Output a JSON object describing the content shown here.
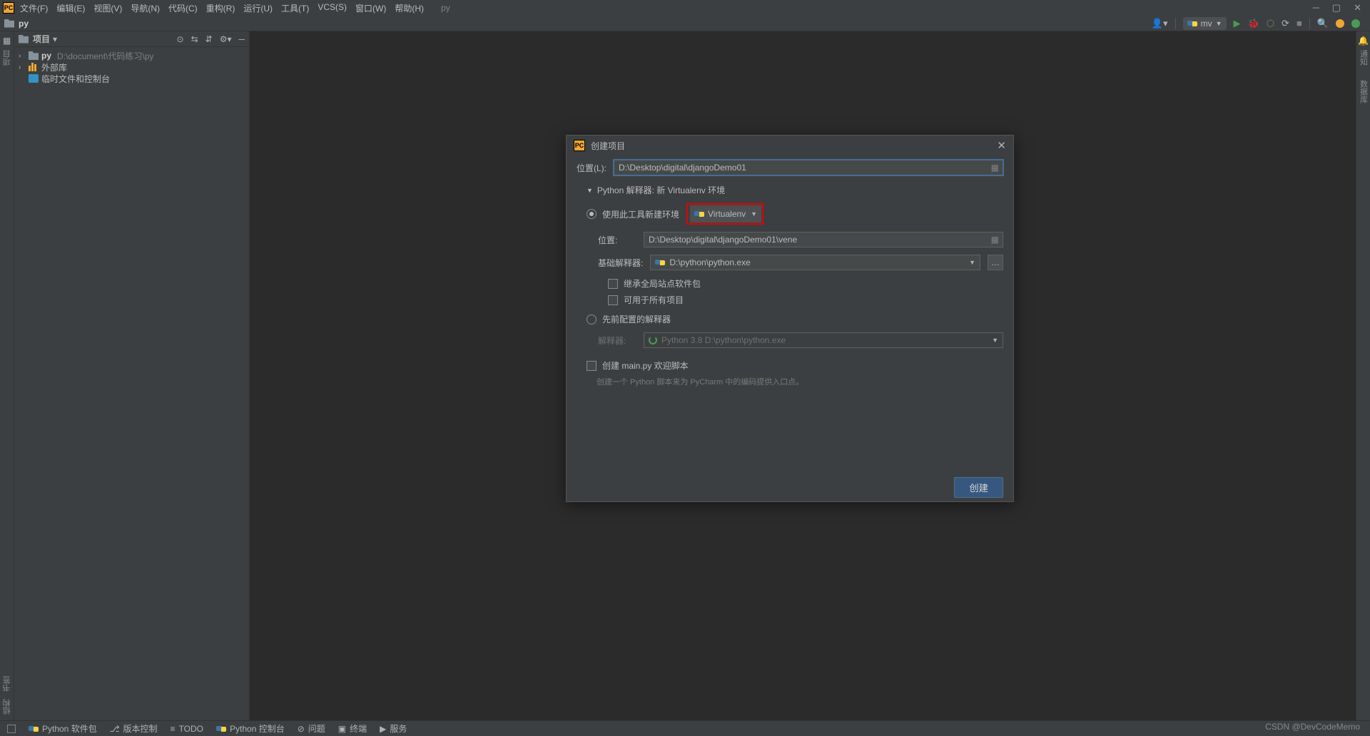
{
  "menu": {
    "file": "文件(F)",
    "edit": "编辑(E)",
    "view": "视图(V)",
    "nav": "导航(N)",
    "code": "代码(C)",
    "refactor": "重构(R)",
    "run": "运行(U)",
    "tools": "工具(T)",
    "vcs": "VCS(S)",
    "window": "窗口(W)",
    "help": "帮助(H)",
    "proj": "py"
  },
  "crumb": {
    "name": "py",
    "config": "mv"
  },
  "sidebar": {
    "title": "项目",
    "root": "py",
    "root_path": "D:\\document\\代码练习\\py",
    "libs": "外部库",
    "scratch": "临时文件和控制台"
  },
  "dialog": {
    "title": "创建项目",
    "loc_label": "位置(L):",
    "loc_value": "D:\\Desktop\\digital\\djangoDemo01",
    "section": "Python 解释器: 新 Virtualenv 环境",
    "radio_new": "使用此工具新建环境",
    "venv_label": "Virtualenv",
    "env_loc_label": "位置:",
    "env_loc_value": "D:\\Desktop\\digital\\djangoDemo01\\vene",
    "base_label": "基础解释器:",
    "base_value": "D:\\python\\python.exe",
    "inherit": "继承全局站点软件包",
    "all_proj": "可用于所有项目",
    "radio_prev": "先前配置的解释器",
    "interp_label": "解释器:",
    "interp_value": "Python 3.8 D:\\python\\python.exe",
    "create_main": "创建 main.py 欢迎脚本",
    "hint": "创建一个 Python 脚本来为 PyCharm 中的编码提供入口点。",
    "create_btn": "创建"
  },
  "status": {
    "packages": "Python 软件包",
    "vcs": "版本控制",
    "todo": "TODO",
    "console": "Python 控制台",
    "problems": "问题",
    "terminal": "终端",
    "services": "服务"
  },
  "left_tabs": {
    "project": "项目",
    "bookmarks": "书签",
    "structure": "结构"
  },
  "right_tabs": {
    "notify": "通知",
    "db": "数据库"
  },
  "watermark": {
    "text": "CSDN @DevCodeMemo",
    "ver": "Python 3.8"
  }
}
